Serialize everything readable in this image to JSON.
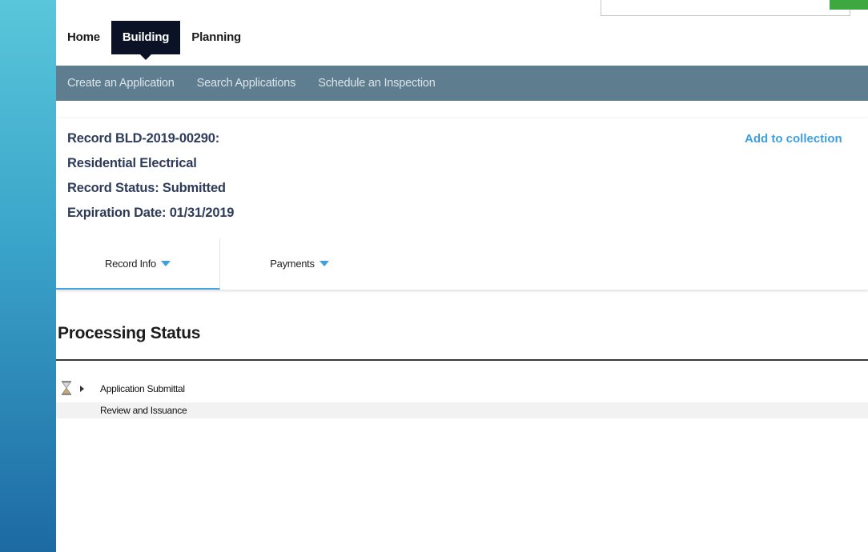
{
  "nav": {
    "tabs": [
      {
        "label": "Home"
      },
      {
        "label": "Building"
      },
      {
        "label": "Planning"
      }
    ]
  },
  "subnav": {
    "items": [
      {
        "label": "Create an Application"
      },
      {
        "label": "Search Applications"
      },
      {
        "label": "Schedule an Inspection"
      }
    ]
  },
  "record": {
    "title": "Record BLD-2019-00290:",
    "type": "Residential Electrical",
    "status": "Record Status: Submitted",
    "expiration": "Expiration Date: 01/31/2019",
    "add_to_collection": "Add to collection"
  },
  "record_tabs": [
    {
      "label": "Record Info"
    },
    {
      "label": "Payments"
    }
  ],
  "processing": {
    "heading": "Processing Status",
    "tasks": [
      {
        "label": "Application Submittal",
        "icon": "hourglass-icon"
      },
      {
        "label": "Review and Issuance"
      }
    ]
  },
  "colors": {
    "subnav_bg": "#5e7d8f",
    "active_tab_bg": "#0c1225",
    "link": "#3f9fde",
    "record_text": "#2e3b5a"
  }
}
